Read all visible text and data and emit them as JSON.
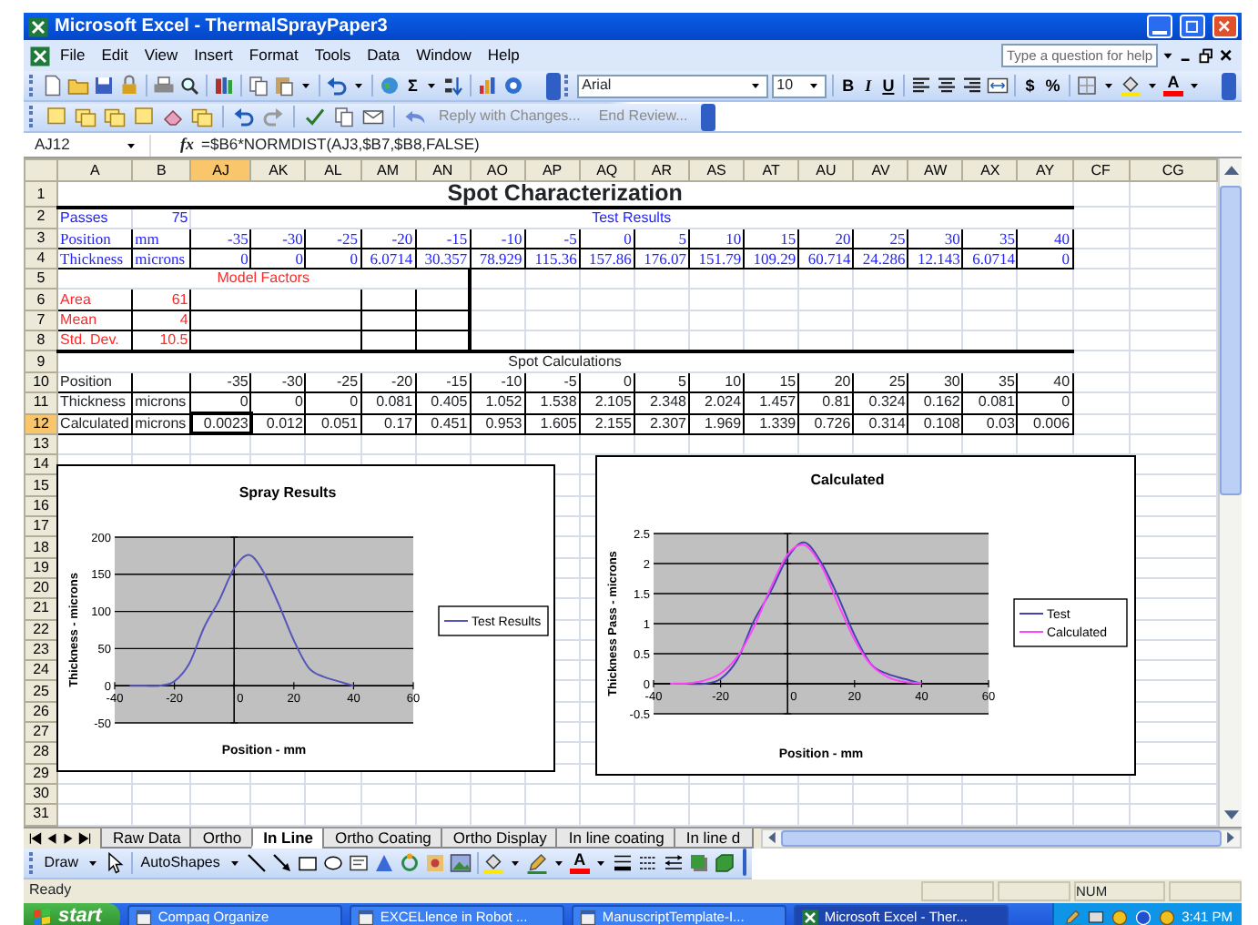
{
  "window": {
    "title": "Microsoft Excel - ThermalSprayPaper3"
  },
  "menu": [
    "File",
    "Edit",
    "View",
    "Insert",
    "Format",
    "Tools",
    "Data",
    "Window",
    "Help"
  ],
  "help_box": {
    "placeholder": "Type a question for help"
  },
  "standard_toolbar": {
    "sum": "Σ"
  },
  "formatting_toolbar": {
    "font": "Arial",
    "size": "10",
    "styles": [
      "B",
      "I",
      "U"
    ],
    "currency": "$",
    "percent": "%",
    "font_color": "A"
  },
  "reviewing_toolbar": {
    "buttons": [
      "Reply with Changes...",
      "End Review..."
    ]
  },
  "formula_bar": {
    "name_box": "AJ12",
    "function_label": "fx",
    "formula": "=$B6*NORMDIST(AJ3,$B7,$B8,FALSE)"
  },
  "sheet": {
    "columns": [
      {
        "label": "A",
        "selected": false
      },
      {
        "label": "B",
        "selected": false
      },
      {
        "label": "AJ",
        "selected": true
      },
      {
        "label": "AK",
        "selected": false
      },
      {
        "label": "AL",
        "selected": false
      },
      {
        "label": "AM",
        "selected": false
      },
      {
        "label": "AN",
        "selected": false
      },
      {
        "label": "AO",
        "selected": false
      },
      {
        "label": "AP",
        "selected": false
      },
      {
        "label": "AQ",
        "selected": false
      },
      {
        "label": "AR",
        "selected": false
      },
      {
        "label": "AS",
        "selected": false
      },
      {
        "label": "AT",
        "selected": false
      },
      {
        "label": "AU",
        "selected": false
      },
      {
        "label": "AV",
        "selected": false
      },
      {
        "label": "AW",
        "selected": false
      },
      {
        "label": "AX",
        "selected": false
      },
      {
        "label": "AY",
        "selected": false
      },
      {
        "label": "CF",
        "selected": false
      },
      {
        "label": "CG",
        "selected": false
      }
    ],
    "rows": [
      {
        "number": "1",
        "selected": false,
        "kind": "title",
        "text": "Spot Characterization"
      },
      {
        "number": "2",
        "selected": false,
        "kind": "test_heading",
        "label": "Passes",
        "value": "75",
        "heading": "Test Results"
      },
      {
        "number": "3",
        "selected": false,
        "kind": "test_series",
        "label": "Position",
        "unit": "mm",
        "values": [
          "-35",
          "-30",
          "-25",
          "-20",
          "-15",
          "-10",
          "-5",
          "0",
          "5",
          "10",
          "15",
          "20",
          "25",
          "30",
          "35",
          "40"
        ]
      },
      {
        "number": "4",
        "selected": false,
        "kind": "test_series",
        "label": "Thickness",
        "unit": "microns",
        "values": [
          "0",
          "0",
          "0",
          "6.0714",
          "30.357",
          "78.929",
          "115.36",
          "157.86",
          "176.07",
          "151.79",
          "109.29",
          "60.714",
          "24.286",
          "12.143",
          "6.0714",
          "0"
        ]
      },
      {
        "number": "5",
        "selected": false,
        "kind": "model_heading",
        "caption": "Model Factors"
      },
      {
        "number": "6",
        "selected": false,
        "kind": "model_factor",
        "label": "Area",
        "value": "61"
      },
      {
        "number": "7",
        "selected": false,
        "kind": "model_factor",
        "label": "Mean",
        "value": "4"
      },
      {
        "number": "8",
        "selected": false,
        "kind": "model_factor",
        "label": "Std. Dev.",
        "value": "10.5"
      },
      {
        "number": "9",
        "selected": false,
        "kind": "calc_heading",
        "heading": "Spot Calculations"
      },
      {
        "number": "10",
        "selected": false,
        "kind": "calc_series",
        "label": "Position",
        "values": [
          "-35",
          "-30",
          "-25",
          "-20",
          "-15",
          "-10",
          "-5",
          "0",
          "5",
          "10",
          "15",
          "20",
          "25",
          "30",
          "35",
          "40"
        ]
      },
      {
        "number": "11",
        "selected": false,
        "kind": "calc_series",
        "label": "Thickness",
        "unit": "microns",
        "values": [
          "0",
          "0",
          "0",
          "0.081",
          "0.405",
          "1.052",
          "1.538",
          "2.105",
          "2.348",
          "2.024",
          "1.457",
          "0.81",
          "0.324",
          "0.162",
          "0.081",
          "0"
        ]
      },
      {
        "number": "12",
        "selected": true,
        "kind": "calc_series",
        "label": "Calculated",
        "unit": "microns",
        "values": [
          "0.0023",
          "0.012",
          "0.051",
          "0.17",
          "0.451",
          "0.953",
          "1.605",
          "2.155",
          "2.307",
          "1.969",
          "1.339",
          "0.726",
          "0.314",
          "0.108",
          "0.03",
          "0.006"
        ]
      },
      {
        "number": "13",
        "selected": false,
        "kind": "blank"
      },
      {
        "number": "14",
        "selected": false,
        "kind": "blank"
      },
      {
        "number": "15",
        "selected": false,
        "kind": "blank"
      },
      {
        "number": "16",
        "selected": false,
        "kind": "blank"
      },
      {
        "number": "17",
        "selected": false,
        "kind": "blank"
      },
      {
        "number": "18",
        "selected": false,
        "kind": "blank"
      },
      {
        "number": "19",
        "selected": false,
        "kind": "blank"
      },
      {
        "number": "20",
        "selected": false,
        "kind": "blank"
      },
      {
        "number": "21",
        "selected": false,
        "kind": "blank"
      },
      {
        "number": "22",
        "selected": false,
        "kind": "blank"
      },
      {
        "number": "23",
        "selected": false,
        "kind": "blank"
      },
      {
        "number": "24",
        "selected": false,
        "kind": "blank"
      },
      {
        "number": "25",
        "selected": false,
        "kind": "blank"
      },
      {
        "number": "26",
        "selected": false,
        "kind": "blank"
      },
      {
        "number": "27",
        "selected": false,
        "kind": "blank"
      },
      {
        "number": "28",
        "selected": false,
        "kind": "blank"
      },
      {
        "number": "29",
        "selected": false,
        "kind": "blank"
      },
      {
        "number": "30",
        "selected": false,
        "kind": "blank"
      },
      {
        "number": "31",
        "selected": false,
        "kind": "blank"
      }
    ]
  },
  "charts": [
    {
      "chart_data": {
        "type": "line",
        "title": "Spray Results",
        "xlabel": "Position - mm",
        "ylabel": "Thickness - microns",
        "x": [
          -35,
          -30,
          -25,
          -20,
          -15,
          -10,
          -5,
          0,
          5,
          10,
          15,
          20,
          25,
          30,
          35,
          40
        ],
        "series": [
          {
            "name": "Test Results",
            "color": "#5555bb",
            "values": [
              0,
              0,
              0,
              6,
              30,
              79,
              115,
              158,
              176,
              152,
              109,
              61,
              24,
              12,
              6,
              0
            ]
          }
        ],
        "xlim": [
          -40,
          60
        ],
        "ylim": [
          -50,
          200
        ],
        "xticks": [
          -40,
          -20,
          0,
          20,
          40,
          60
        ],
        "yticks": [
          -50,
          0,
          50,
          100,
          150,
          200
        ],
        "grid": true,
        "legend": "right"
      }
    },
    {
      "chart_data": {
        "type": "line",
        "title": "Calculated",
        "xlabel": "Position - mm",
        "ylabel": "Thickness Pass - microns",
        "x": [
          -35,
          -30,
          -25,
          -20,
          -15,
          -10,
          -5,
          0,
          5,
          10,
          15,
          20,
          25,
          30,
          35,
          40
        ],
        "series": [
          {
            "name": "Test",
            "color": "#4444aa",
            "values": [
              0,
              0,
              0,
              0.08,
              0.4,
              1.05,
              1.54,
              2.1,
              2.35,
              2.02,
              1.46,
              0.81,
              0.32,
              0.16,
              0.08,
              0
            ]
          },
          {
            "name": "Calculated",
            "color": "#ff44ff",
            "values": [
              0,
              0.01,
              0.05,
              0.17,
              0.45,
              0.95,
              1.6,
              2.15,
              2.31,
              1.97,
              1.34,
              0.73,
              0.31,
              0.11,
              0.03,
              0.01
            ]
          }
        ],
        "xlim": [
          -40,
          60
        ],
        "ylim": [
          -0.5,
          2.5
        ],
        "xticks": [
          -40,
          -20,
          0,
          20,
          40,
          60
        ],
        "yticks": [
          -0.5,
          0,
          0.5,
          1,
          1.5,
          2,
          2.5
        ],
        "grid": true,
        "legend": "right"
      }
    }
  ],
  "sheet_tabs": [
    {
      "label": "Raw Data",
      "selected": false
    },
    {
      "label": "Ortho",
      "selected": false
    },
    {
      "label": "In Line",
      "selected": true
    },
    {
      "label": "Ortho Coating",
      "selected": false
    },
    {
      "label": "Ortho Display",
      "selected": false
    },
    {
      "label": "In line coating",
      "selected": false
    },
    {
      "label": "In line d",
      "selected": false
    }
  ],
  "draw_toolbar": {
    "draw": "Draw",
    "autoshapes": "AutoShapes",
    "font_color": "A"
  },
  "status_bar": {
    "status": "Ready",
    "indicator": "NUM"
  },
  "taskbar": {
    "start": "start",
    "tasks": [
      {
        "label": "Compaq Organize",
        "selected": false
      },
      {
        "label": "EXCELlence in Robot ...",
        "selected": false
      },
      {
        "label": "ManuscriptTemplate-I...",
        "selected": false
      },
      {
        "label": "Microsoft Excel - Ther...",
        "selected": true
      }
    ],
    "clock": "3:41 PM"
  }
}
